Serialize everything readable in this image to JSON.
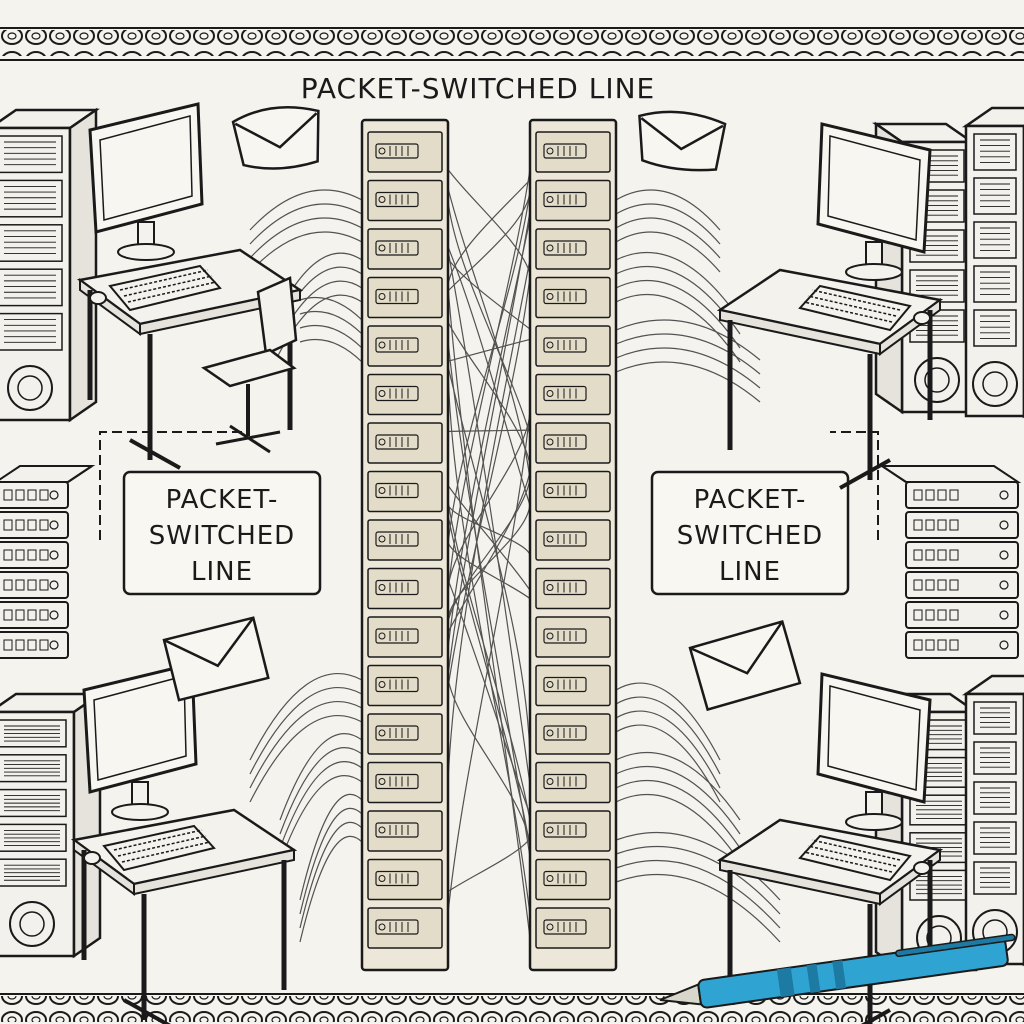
{
  "header": {
    "title": "PACKET-SWITCHED LINE"
  },
  "callouts": {
    "left": {
      "line1": "PACKET-",
      "line2": "SWITCHED",
      "line3": "LINE"
    },
    "right": {
      "line1": "PACKET-",
      "line2": "SWITCHED",
      "line3": "LINE"
    }
  },
  "colors": {
    "paper": "#f4f3ee",
    "ink": "#1a1a1a",
    "rack_fill": "#ece7d8",
    "pen_body": "#2fa3d1",
    "pen_dark": "#1d7aa3"
  },
  "icons": [
    "server-tower-icon",
    "computer-monitor-icon",
    "keyboard-icon",
    "desk-icon",
    "office-chair-icon",
    "envelope-icon",
    "server-rack-icon",
    "pen-icon"
  ]
}
